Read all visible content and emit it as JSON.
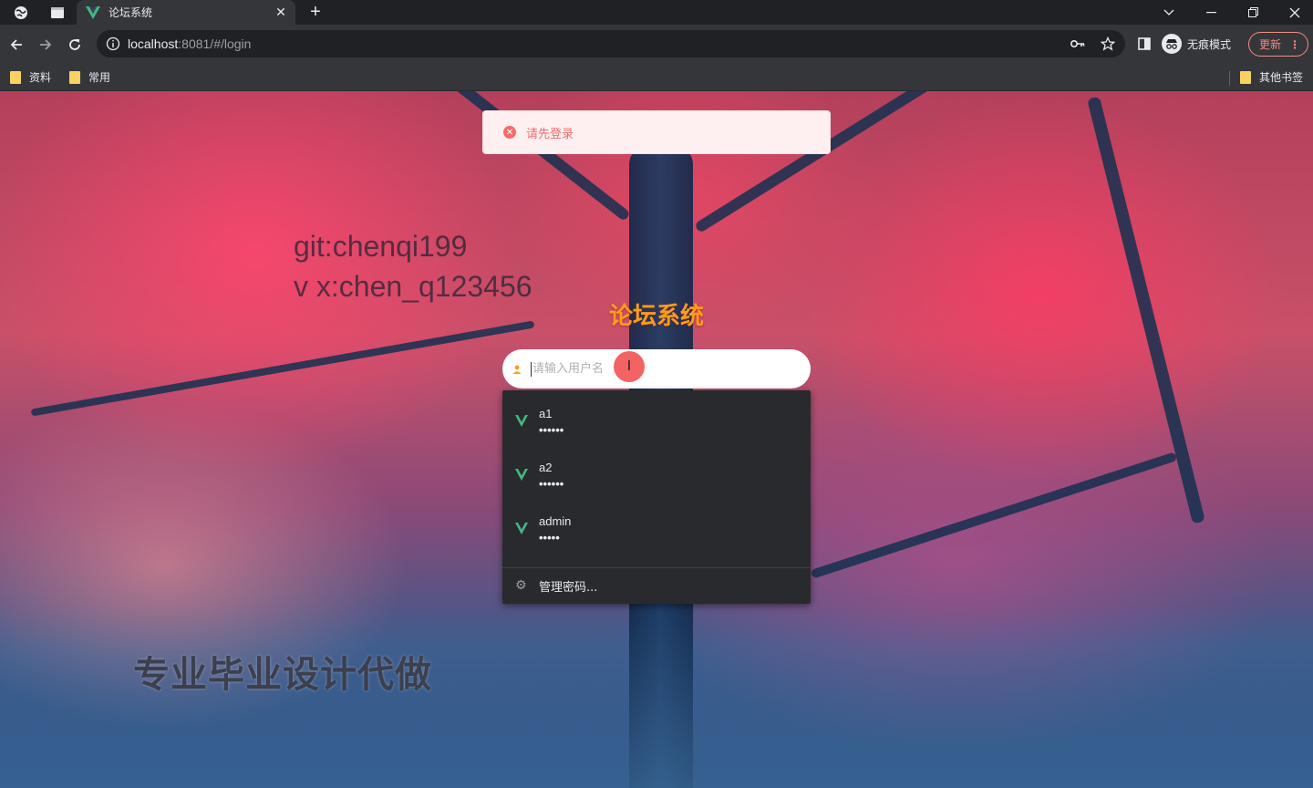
{
  "browser": {
    "tab_title": "论坛系统",
    "url_host": "localhost",
    "url_rest": ":8081/#/login",
    "incognito_label": "无痕模式",
    "update_label": "更新",
    "bookmarks": [
      "资料",
      "常用"
    ],
    "other_bookmarks": "其他书签"
  },
  "page": {
    "toast_message": "请先登录",
    "title": "论坛系统",
    "username_placeholder": "请输入用户名",
    "watermark_line1": "git:chenqi199",
    "watermark_line2": "v x:chen_q123456",
    "watermark_bottom": "专业毕业设计代做"
  },
  "autofill": {
    "entries": [
      {
        "username": "a1",
        "password_mask": "••••••"
      },
      {
        "username": "a2",
        "password_mask": "••••••"
      },
      {
        "username": "admin",
        "password_mask": "•••••"
      }
    ],
    "manage_label": "管理密码..."
  },
  "colors": {
    "title": "#ff9a1f",
    "toast_text": "#f56c6c",
    "vue_green": "#41b883"
  }
}
